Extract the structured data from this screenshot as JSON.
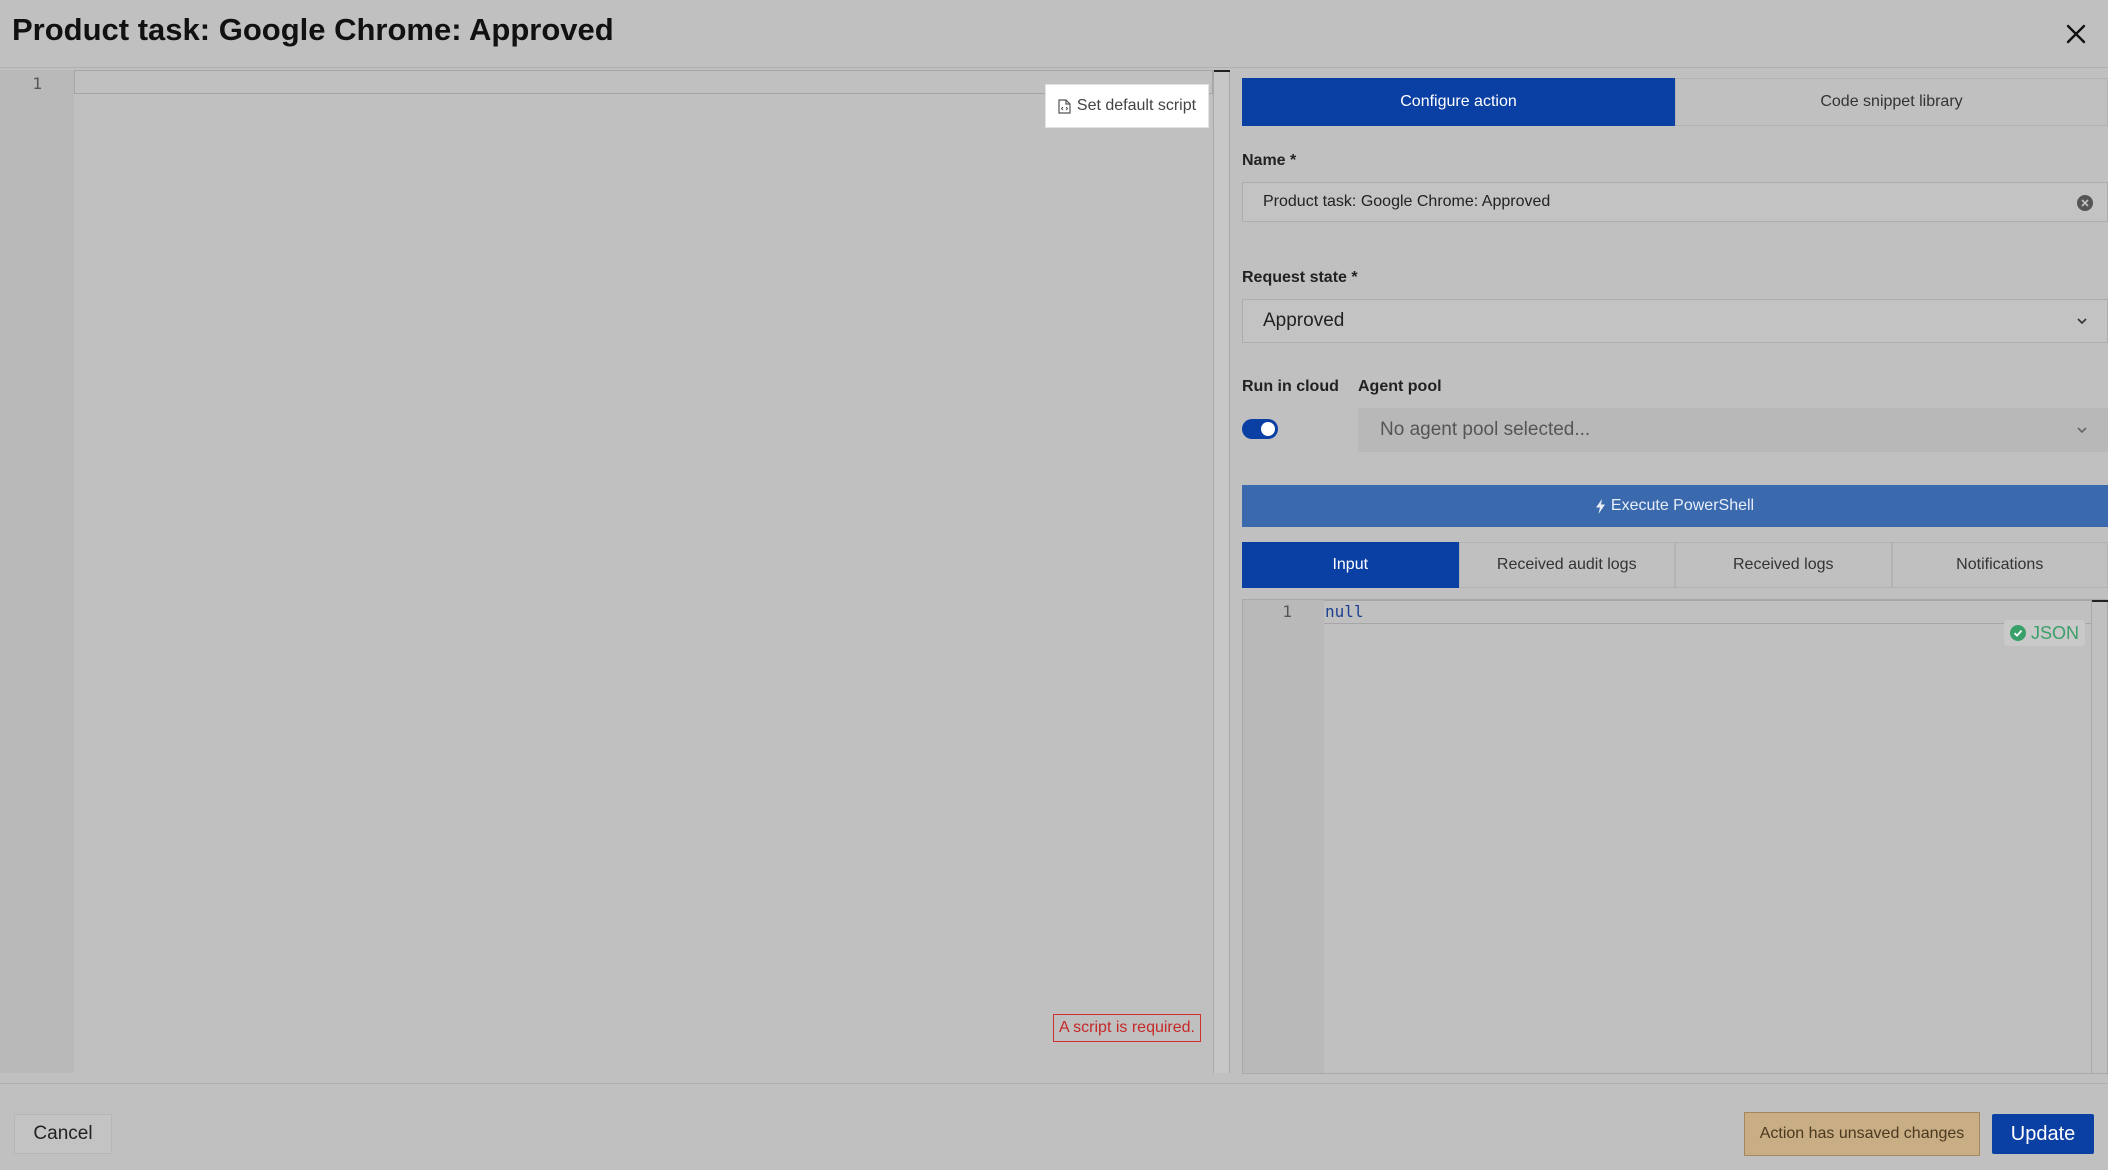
{
  "dialog": {
    "title": "Product task: Google Chrome: Approved",
    "close_icon": "close-icon"
  },
  "script_editor": {
    "line_number": "1",
    "set_default_label": "Set default script",
    "set_default_icon": "file-code-icon",
    "error_text": "A script is required."
  },
  "panel": {
    "tabs": [
      {
        "label": "Configure action",
        "active": true
      },
      {
        "label": "Code snippet library",
        "active": false
      }
    ],
    "name": {
      "label": "Name *",
      "value": "Product task: Google Chrome: Approved",
      "clear_icon": "clear-circle-icon"
    },
    "request_state": {
      "label": "Request state *",
      "value": "Approved"
    },
    "run_in_cloud": {
      "label": "Run in cloud",
      "enabled": true
    },
    "agent_pool": {
      "label": "Agent pool",
      "placeholder": "No agent pool selected..."
    },
    "execute_button": {
      "label": "Execute PowerShell",
      "icon": "lightning-icon"
    },
    "subtabs": [
      {
        "label": "Input",
        "active": true
      },
      {
        "label": "Received audit logs",
        "active": false
      },
      {
        "label": "Received logs",
        "active": false
      },
      {
        "label": "Notifications",
        "active": false
      }
    ],
    "json_editor": {
      "line_number": "1",
      "content": "null",
      "badge": "JSON",
      "badge_icon": "check-circle-icon"
    }
  },
  "footer": {
    "cancel_label": "Cancel",
    "unsaved_text": "Action has unsaved changes",
    "update_label": "Update"
  },
  "colors": {
    "primary": "#0a3fa4",
    "execute": "#3a69ad",
    "error": "#c62828",
    "warning_bg": "#c9ad84",
    "json_ok": "#3aa06a"
  }
}
